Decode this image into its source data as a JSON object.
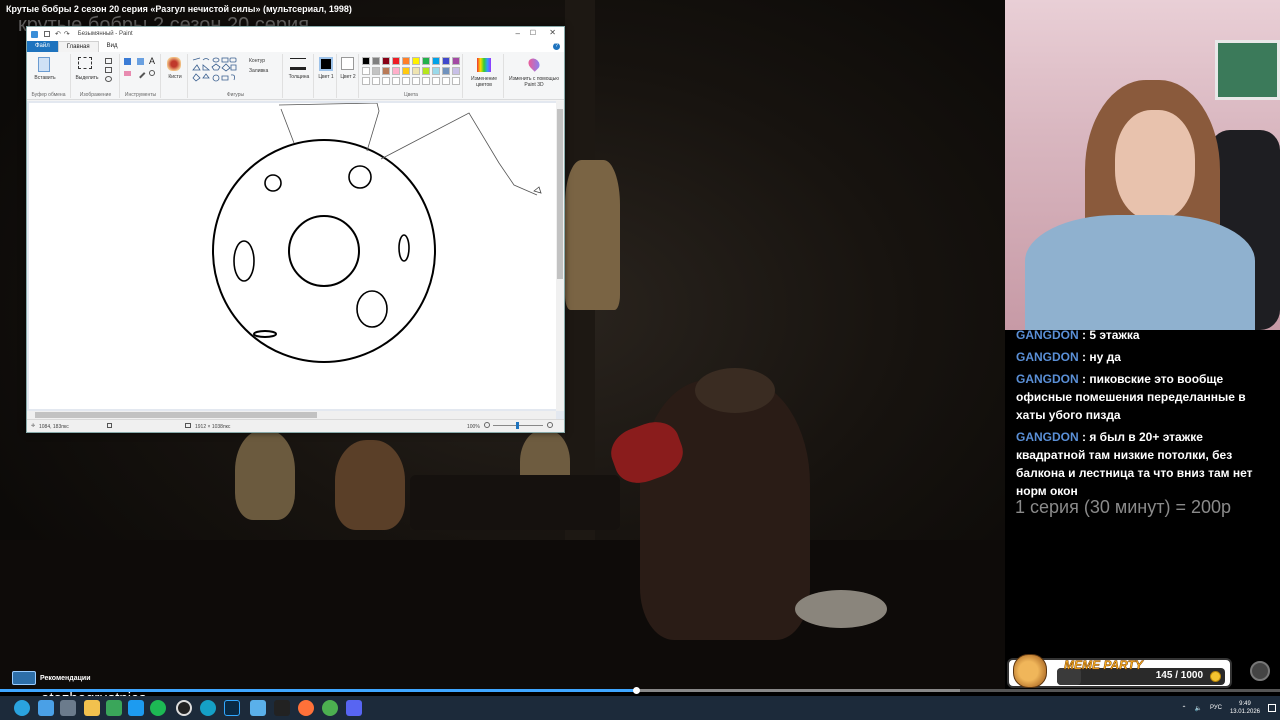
{
  "video": {
    "title": "Крутые бобры 2 сезон 20 серия «Разгул нечистой силы» (мультсериал, 1998)",
    "title_ghost": "крутые бобры 2 сезон 20 серия",
    "progress_fraction": 0.497,
    "buffer_fraction": 0.75
  },
  "paint": {
    "window_title": "Безымянный - Paint",
    "menu": [
      "Файл",
      "Главная",
      "Вид"
    ],
    "groups": {
      "clipboard": "Буфер обмена",
      "paste": "Вставить",
      "image": "Изображение",
      "select": "Выделить",
      "tools": "Инструменты",
      "brushes": "Кисти",
      "shapes": "Фигуры",
      "outline": "Контур",
      "fill": "Заливка",
      "thickness": "Толщина",
      "color1": "Цвет 1",
      "color2": "Цвет 2",
      "colors": "Цвета",
      "edit_colors": "Изменение цветов",
      "paint3d": "Изменить с помощью Paint 3D"
    },
    "palette": [
      "#000000",
      "#7f7f7f",
      "#880015",
      "#ed1c24",
      "#ff7f27",
      "#fff200",
      "#22b14c",
      "#00a2e8",
      "#3f48cc",
      "#a349a4",
      "#ffffff",
      "#c3c3c3",
      "#b97a57",
      "#ffaec9",
      "#ffc90e",
      "#efe4b0",
      "#b5e61d",
      "#99d9ea",
      "#7092be",
      "#c8bfe7"
    ],
    "status": {
      "cursor_pos": "1084, 183пкс",
      "canvas_size": "1912 × 1038пкс",
      "zoom": "100%"
    }
  },
  "chat": {
    "messages": [
      {
        "user": "GANGDON",
        "text": "5 этажка"
      },
      {
        "user": "GANGDON",
        "text": "ну да"
      },
      {
        "user": "GANGDON",
        "text": "пиковские это вообще офисные помешения переделанные в хаты убого пизда"
      },
      {
        "user": "GANGDON",
        "text": "я был в 20+ этажке квадратной там низкие потолки, без балкона и лестница та что вниз там нет норм окон"
      }
    ],
    "price_line": "1 серия (30 минут) = 200р"
  },
  "recommendations_label": "Рекомендации",
  "channel_name": "etozhegrustnica",
  "meme_party": {
    "title": "MEME PARTY",
    "count": "145 / 1000",
    "progress_fraction": 0.145
  },
  "taskbar": {
    "lang": "РУС",
    "time": "9:49",
    "date": "13.01.2026"
  }
}
